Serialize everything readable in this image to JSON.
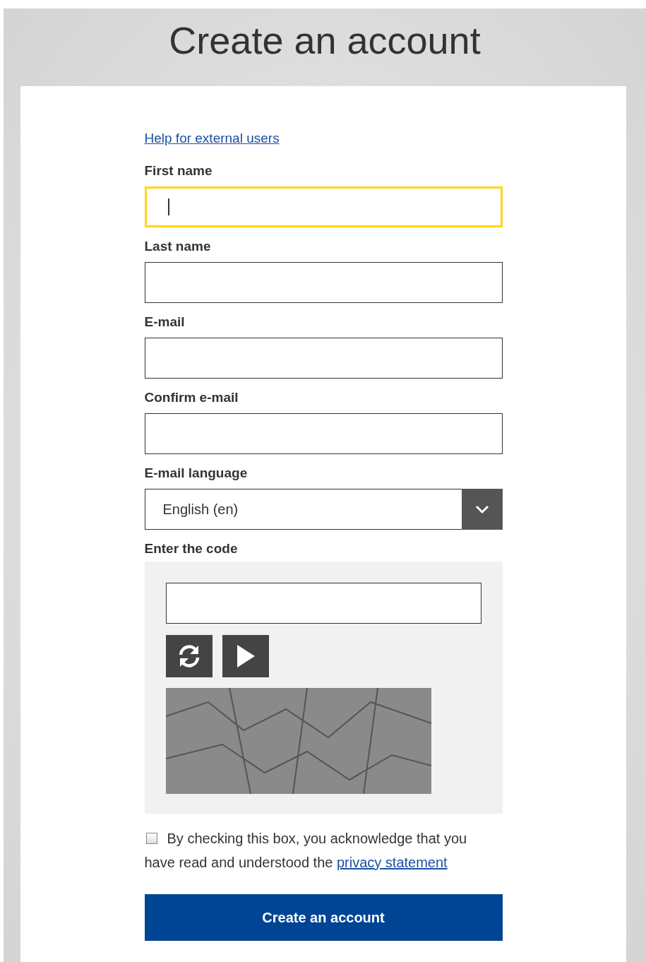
{
  "page_title": "Create an account",
  "help_link": "Help for external users",
  "fields": [
    {
      "kind": "text",
      "label": "First name",
      "focused": true
    },
    {
      "kind": "text",
      "label": "Last name",
      "focused": false
    },
    {
      "kind": "text",
      "label": "E-mail",
      "focused": false
    },
    {
      "kind": "text",
      "label": "Confirm e-mail",
      "focused": false
    },
    {
      "kind": "select",
      "label": "E-mail language",
      "value": "English (en)",
      "focused": false
    }
  ],
  "captcha": {
    "label": "Enter the code"
  },
  "consent": {
    "checked": false,
    "text": "By checking this box, you acknowledge that you have read and understood the",
    "link": "privacy statement"
  },
  "submit": "Create an account"
}
